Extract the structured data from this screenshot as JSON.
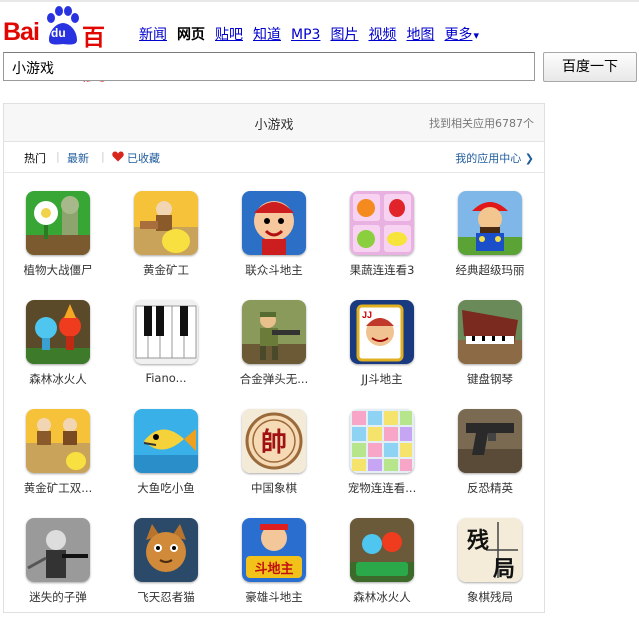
{
  "logo": {
    "part1": "Bai",
    "part2": "du",
    "part3": "百度"
  },
  "nav": [
    {
      "label": "新闻",
      "current": false
    },
    {
      "label": "网页",
      "current": true
    },
    {
      "label": "贴吧",
      "current": false
    },
    {
      "label": "知道",
      "current": false
    },
    {
      "label": "MP3",
      "current": false
    },
    {
      "label": "图片",
      "current": false
    },
    {
      "label": "视频",
      "current": false
    },
    {
      "label": "地图",
      "current": false
    },
    {
      "label": "更多",
      "current": false
    }
  ],
  "nav_more_arrow": "▾",
  "search": {
    "value": "小游戏",
    "button": "百度一下"
  },
  "panel": {
    "title": "小游戏",
    "count": "找到相关应用6787个",
    "tabs": {
      "hot": "热门",
      "sep": "|",
      "latest": "最新",
      "favorites": "已收藏"
    },
    "app_center": "我的应用中心 ❯"
  },
  "apps": [
    {
      "name": "植物大战僵尸",
      "icon": "plants-zombies-icon"
    },
    {
      "name": "黄金矿工",
      "icon": "gold-miner-icon"
    },
    {
      "name": "联众斗地主",
      "icon": "lianzhong-doudizhu-icon"
    },
    {
      "name": "果蔬连连看3",
      "icon": "fruit-match-icon"
    },
    {
      "name": "经典超级玛丽",
      "icon": "super-mario-icon"
    },
    {
      "name": "森林冰火人",
      "icon": "fire-ice-icon"
    },
    {
      "name": "Fiano...",
      "icon": "piano-keys-icon"
    },
    {
      "name": "合金弹头无...",
      "icon": "metal-slug-icon"
    },
    {
      "name": "JJ斗地主",
      "icon": "jj-doudizhu-icon"
    },
    {
      "name": "键盘钢琴",
      "icon": "grand-piano-icon"
    },
    {
      "name": "黄金矿工双...",
      "icon": "gold-miner-double-icon"
    },
    {
      "name": "大鱼吃小鱼",
      "icon": "fish-icon"
    },
    {
      "name": "中国象棋",
      "icon": "chinese-chess-icon"
    },
    {
      "name": "宠物连连看...",
      "icon": "pet-match-icon"
    },
    {
      "name": "反恐精英",
      "icon": "counter-strike-icon"
    },
    {
      "name": "迷失的子弹",
      "icon": "lost-bullet-icon"
    },
    {
      "name": "飞天忍者猫",
      "icon": "ninja-cat-icon"
    },
    {
      "name": "豪雄斗地主",
      "icon": "haoxiong-doudizhu-icon"
    },
    {
      "name": "森林冰火人",
      "icon": "fire-ice-2-icon"
    },
    {
      "name": "象棋残局",
      "icon": "chess-endgame-icon"
    }
  ],
  "icon_text": {
    "chess_piece": "帥",
    "doudizhu": "斗地主",
    "endgame1": "残",
    "endgame2": "局",
    "jj": "JJ"
  },
  "colors": {
    "brand_red": "#e10601",
    "brand_blue": "#2932e1",
    "link_blue": "#0000cc"
  }
}
